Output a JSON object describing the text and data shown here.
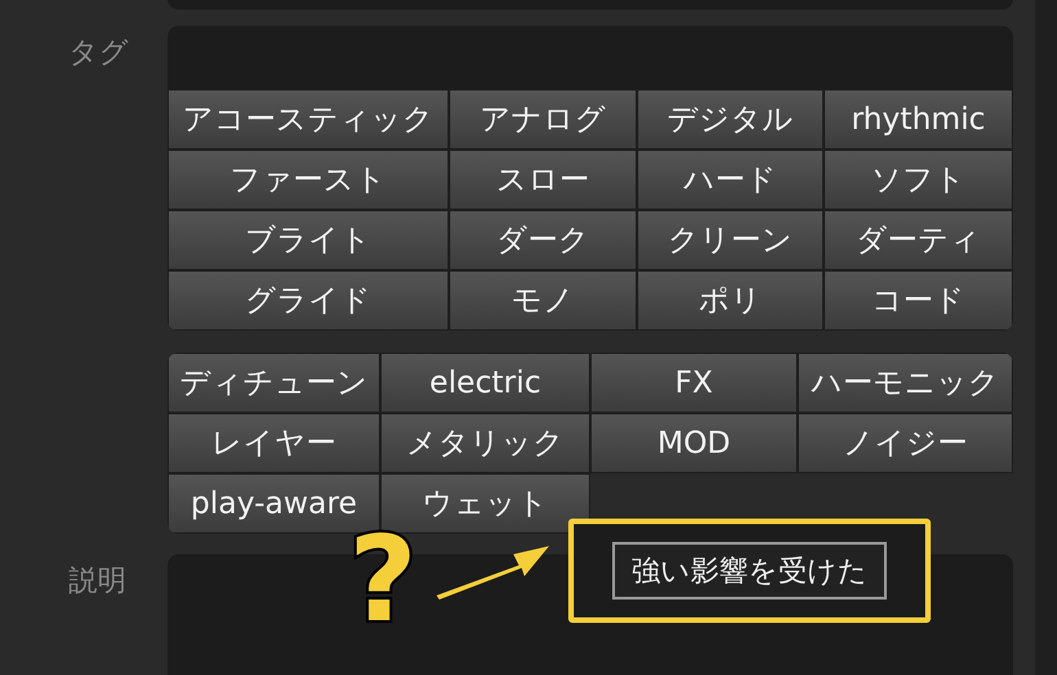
{
  "tags_label": "タグ",
  "tag_grid_1": [
    "アコースティック",
    "アナログ",
    "デジタル",
    "rhythmic",
    "ファースト",
    "スロー",
    "ハード",
    "ソフト",
    "ブライト",
    "ダーク",
    "クリーン",
    "ダーティ",
    "グライド",
    "モノ",
    "ポリ",
    "コード"
  ],
  "tag_grid_2": [
    "ディチューン",
    "electric",
    "FX",
    "ハーモニック",
    "レイヤー",
    "メタリック",
    "MOD",
    "ノイジー",
    "play-aware",
    "ウェット"
  ],
  "description_label": "説明",
  "annotation": {
    "mark": "?",
    "suggested_tag": "強い影響を受けた"
  }
}
